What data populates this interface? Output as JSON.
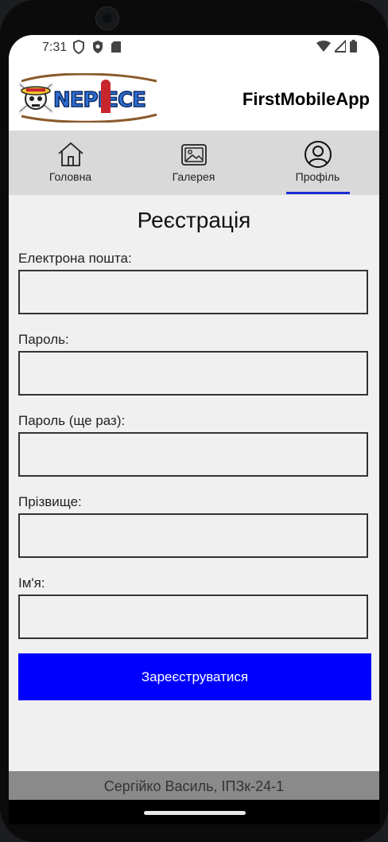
{
  "status_bar": {
    "time": "7:31",
    "left_icons": [
      "shield-outline-icon",
      "shield-filled-icon",
      "sd-card-icon"
    ],
    "right_icons": [
      "wifi-icon",
      "signal-icon",
      "battery-icon"
    ]
  },
  "app_bar": {
    "logo_text": "ONE PIECE",
    "title": "FirstMobileApp"
  },
  "tabs": [
    {
      "label": "Головна",
      "icon": "home-icon"
    },
    {
      "label": "Галерея",
      "icon": "gallery-icon"
    },
    {
      "label": "Профіль",
      "icon": "profile-icon",
      "selected": true
    }
  ],
  "form": {
    "title": "Реєстрація",
    "fields": [
      {
        "label": "Електрона пошта:",
        "value": ""
      },
      {
        "label": "Пароль:",
        "value": ""
      },
      {
        "label": "Пароль (ще раз):",
        "value": ""
      },
      {
        "label": "Прізвище:",
        "value": ""
      },
      {
        "label": "Ім'я:",
        "value": ""
      }
    ],
    "submit_label": "Зареєструватися"
  },
  "footer": {
    "text": "Сергійко Василь, ІПЗк-24-1"
  },
  "colors": {
    "accent": "#0000ff",
    "tab_indicator": "#1a2bd6",
    "tab_background": "#d9d9d9",
    "footer_background": "#8a8a8a"
  }
}
